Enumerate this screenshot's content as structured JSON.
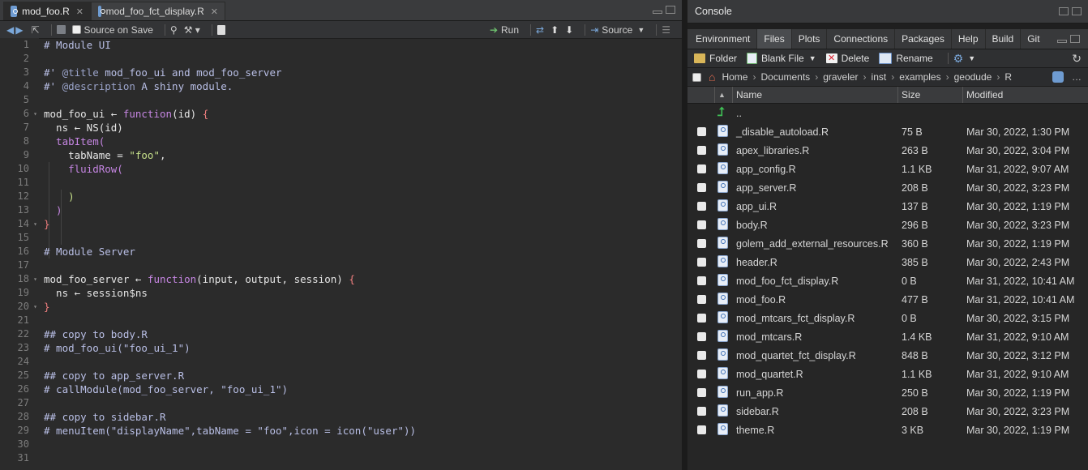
{
  "editor": {
    "tabs": [
      {
        "label": "mod_foo.R"
      },
      {
        "label": "mod_foo_fct_display.R"
      }
    ],
    "toolbar": {
      "source_on_save": "Source on Save",
      "run": "Run",
      "source": "Source"
    },
    "line_numbers": [
      "1",
      "2",
      "3",
      "4",
      "5",
      "6",
      "7",
      "8",
      "9",
      "10",
      "11",
      "12",
      "13",
      "14",
      "15",
      "16",
      "17",
      "18",
      "19",
      "20",
      "21",
      "22",
      "23",
      "24",
      "25",
      "26",
      "27",
      "28",
      "29",
      "30",
      "31"
    ]
  },
  "console": {
    "title": "Console"
  },
  "panel": {
    "tabs": [
      "Environment",
      "Files",
      "Plots",
      "Connections",
      "Packages",
      "Help",
      "Build",
      "Git"
    ],
    "toolbar": {
      "folder": "Folder",
      "blank_file": "Blank File",
      "delete": "Delete",
      "rename": "Rename"
    },
    "breadcrumbs": [
      "Home",
      "Documents",
      "graveler",
      "inst",
      "examples",
      "geodude",
      "R"
    ],
    "columns": {
      "name": "Name",
      "size": "Size",
      "modified": "Modified"
    },
    "parent": "..",
    "files": [
      {
        "name": "_disable_autoload.R",
        "size": "75 B",
        "modified": "Mar 30, 2022, 1:30 PM"
      },
      {
        "name": "apex_libraries.R",
        "size": "263 B",
        "modified": "Mar 30, 2022, 3:04 PM"
      },
      {
        "name": "app_config.R",
        "size": "1.1 KB",
        "modified": "Mar 31, 2022, 9:07 AM"
      },
      {
        "name": "app_server.R",
        "size": "208 B",
        "modified": "Mar 30, 2022, 3:23 PM"
      },
      {
        "name": "app_ui.R",
        "size": "137 B",
        "modified": "Mar 30, 2022, 1:19 PM"
      },
      {
        "name": "body.R",
        "size": "296 B",
        "modified": "Mar 30, 2022, 3:23 PM"
      },
      {
        "name": "golem_add_external_resources.R",
        "size": "360 B",
        "modified": "Mar 30, 2022, 1:19 PM"
      },
      {
        "name": "header.R",
        "size": "385 B",
        "modified": "Mar 30, 2022, 2:43 PM"
      },
      {
        "name": "mod_foo_fct_display.R",
        "size": "0 B",
        "modified": "Mar 31, 2022, 10:41 AM"
      },
      {
        "name": "mod_foo.R",
        "size": "477 B",
        "modified": "Mar 31, 2022, 10:41 AM"
      },
      {
        "name": "mod_mtcars_fct_display.R",
        "size": "0 B",
        "modified": "Mar 30, 2022, 3:15 PM"
      },
      {
        "name": "mod_mtcars.R",
        "size": "1.4 KB",
        "modified": "Mar 31, 2022, 9:10 AM"
      },
      {
        "name": "mod_quartet_fct_display.R",
        "size": "848 B",
        "modified": "Mar 30, 2022, 3:12 PM"
      },
      {
        "name": "mod_quartet.R",
        "size": "1.1 KB",
        "modified": "Mar 31, 2022, 9:10 AM"
      },
      {
        "name": "run_app.R",
        "size": "250 B",
        "modified": "Mar 30, 2022, 1:19 PM"
      },
      {
        "name": "sidebar.R",
        "size": "208 B",
        "modified": "Mar 30, 2022, 3:23 PM"
      },
      {
        "name": "theme.R",
        "size": "3 KB",
        "modified": "Mar 30, 2022, 1:19 PM"
      }
    ]
  },
  "code_lines": [
    [
      {
        "t": "# Module UI",
        "c": "com"
      }
    ],
    [],
    [
      {
        "t": "#' ",
        "c": "com"
      },
      {
        "t": "@title",
        "c": "tag"
      },
      {
        "t": " mod_foo_ui and mod_foo_server",
        "c": "com"
      }
    ],
    [
      {
        "t": "#' ",
        "c": "com"
      },
      {
        "t": "@description",
        "c": "tag"
      },
      {
        "t": " A shiny module.",
        "c": "com"
      }
    ],
    [],
    [
      {
        "t": "mod_foo_ui ",
        "c": "fn"
      },
      {
        "t": "←",
        "c": "fn"
      },
      {
        "t": " ",
        "c": "fn"
      },
      {
        "t": "function",
        "c": "kw"
      },
      {
        "t": "(id) ",
        "c": "fn"
      },
      {
        "t": "{",
        "c": "brc"
      }
    ],
    [
      {
        "t": "  ns ← NS(id)",
        "c": "fn"
      }
    ],
    [
      {
        "t": "  tabItem(",
        "c": "kw"
      }
    ],
    [
      {
        "t": "    tabName = ",
        "c": "fn"
      },
      {
        "t": "\"foo\"",
        "c": "str"
      },
      {
        "t": ",",
        "c": "fn"
      }
    ],
    [
      {
        "t": "    fluidRow(",
        "c": "kw"
      }
    ],
    [],
    [
      {
        "t": "    )",
        "c": "str"
      }
    ],
    [
      {
        "t": "  )",
        "c": "kw"
      }
    ],
    [
      {
        "t": "}",
        "c": "brc"
      }
    ],
    [],
    [
      {
        "t": "# Module Server",
        "c": "com"
      }
    ],
    [],
    [
      {
        "t": "mod_foo_server ← ",
        "c": "fn"
      },
      {
        "t": "function",
        "c": "kw"
      },
      {
        "t": "(input, output, session) ",
        "c": "fn"
      },
      {
        "t": "{",
        "c": "brc"
      }
    ],
    [
      {
        "t": "  ns ← session$ns",
        "c": "fn"
      }
    ],
    [
      {
        "t": "}",
        "c": "brc"
      }
    ],
    [],
    [
      {
        "t": "## copy to body.R",
        "c": "com"
      }
    ],
    [
      {
        "t": "# mod_foo_ui(\"foo_ui_1\")",
        "c": "com"
      }
    ],
    [],
    [
      {
        "t": "## copy to app_server.R",
        "c": "com"
      }
    ],
    [
      {
        "t": "# callModule(mod_foo_server, \"foo_ui_1\")",
        "c": "com"
      }
    ],
    [],
    [
      {
        "t": "## copy to sidebar.R",
        "c": "com"
      }
    ],
    [
      {
        "t": "# menuItem(\"displayName\",tabName = \"foo\",icon = icon(\"user\"))",
        "c": "com"
      }
    ],
    [],
    []
  ],
  "fold_lines": [
    6,
    14,
    18,
    20
  ]
}
